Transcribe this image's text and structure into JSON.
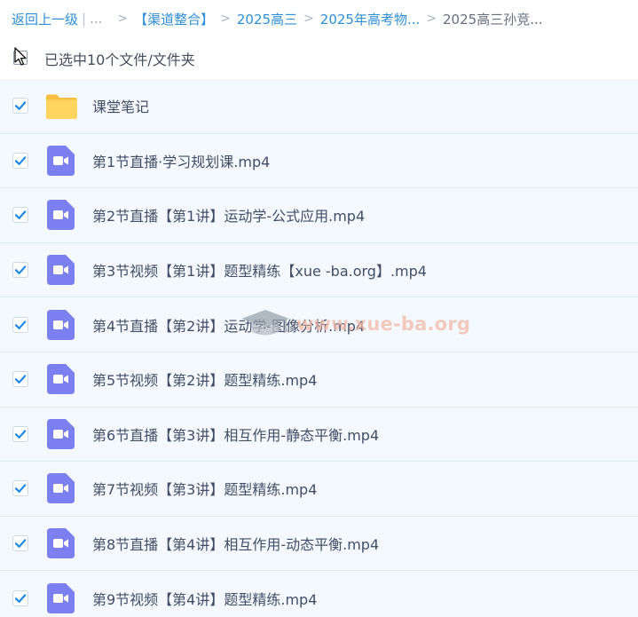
{
  "breadcrumb": {
    "back_label": "返回上一级",
    "sep_bar": "|",
    "ellipsis": "...",
    "arrow": ">",
    "items": [
      "【渠道整合】",
      "2025高三",
      "2025年高考物..."
    ],
    "current": "2025高三孙竞..."
  },
  "selection": {
    "text": "已选中10个文件/文件夹"
  },
  "files": [
    {
      "name": "课堂笔记",
      "type": "folder",
      "checked": true
    },
    {
      "name": "第1节直播·学习规划课.mp4",
      "type": "video",
      "checked": true
    },
    {
      "name": "第2节直播【第1讲】运动学-公式应用.mp4",
      "type": "video",
      "checked": true
    },
    {
      "name": "第3节视频【第1讲】题型精练【xue -ba.org】.mp4",
      "type": "video",
      "checked": true
    },
    {
      "name": "第4节直播【第2讲】运动学-图像分析.mp4",
      "type": "video",
      "checked": true
    },
    {
      "name": "第5节视频【第2讲】题型精练.mp4",
      "type": "video",
      "checked": true
    },
    {
      "name": "第6节直播【第3讲】相互作用-静态平衡.mp4",
      "type": "video",
      "checked": true
    },
    {
      "name": "第7节视频【第3讲】题型精练.mp4",
      "type": "video",
      "checked": true
    },
    {
      "name": "第8节直播【第4讲】相互作用-动态平衡.mp4",
      "type": "video",
      "checked": true
    },
    {
      "name": "第9节视频【第4讲】题型精练.mp4",
      "type": "video",
      "checked": true
    }
  ],
  "watermark": {
    "text": "www.xue-ba.org"
  },
  "colors": {
    "link": "#2f8fd8",
    "check": "#1e88e5",
    "video_icon": "#7b7ff0",
    "folder": "#ffd15c",
    "row_bg": "#f3f9fe"
  },
  "icons": {
    "folder": "folder-icon",
    "video": "video-file-icon",
    "check": "checkmark-icon",
    "cursor": "mouse-cursor-icon",
    "watermark": "graduation-cap-icon"
  }
}
